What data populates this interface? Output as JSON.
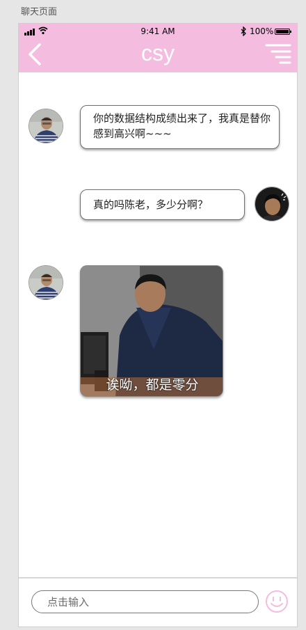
{
  "page_label": "聊天页面",
  "status_bar": {
    "time": "9:41 AM",
    "battery_percent": "100%",
    "bluetooth_glyph": "✱"
  },
  "nav": {
    "title": "csy"
  },
  "messages": [
    {
      "side": "left",
      "type": "text",
      "text": "你的数据结构成绩出来了，我真是替你感到高兴啊~~~"
    },
    {
      "side": "right",
      "type": "text",
      "text": "真的吗陈老，多少分啊？"
    },
    {
      "side": "left",
      "type": "image",
      "caption": "诶呦，都是零分"
    }
  ],
  "input": {
    "placeholder": "点击输入"
  },
  "colors": {
    "header": "#f4bde0",
    "emoji_icon": "#f4bde0"
  }
}
